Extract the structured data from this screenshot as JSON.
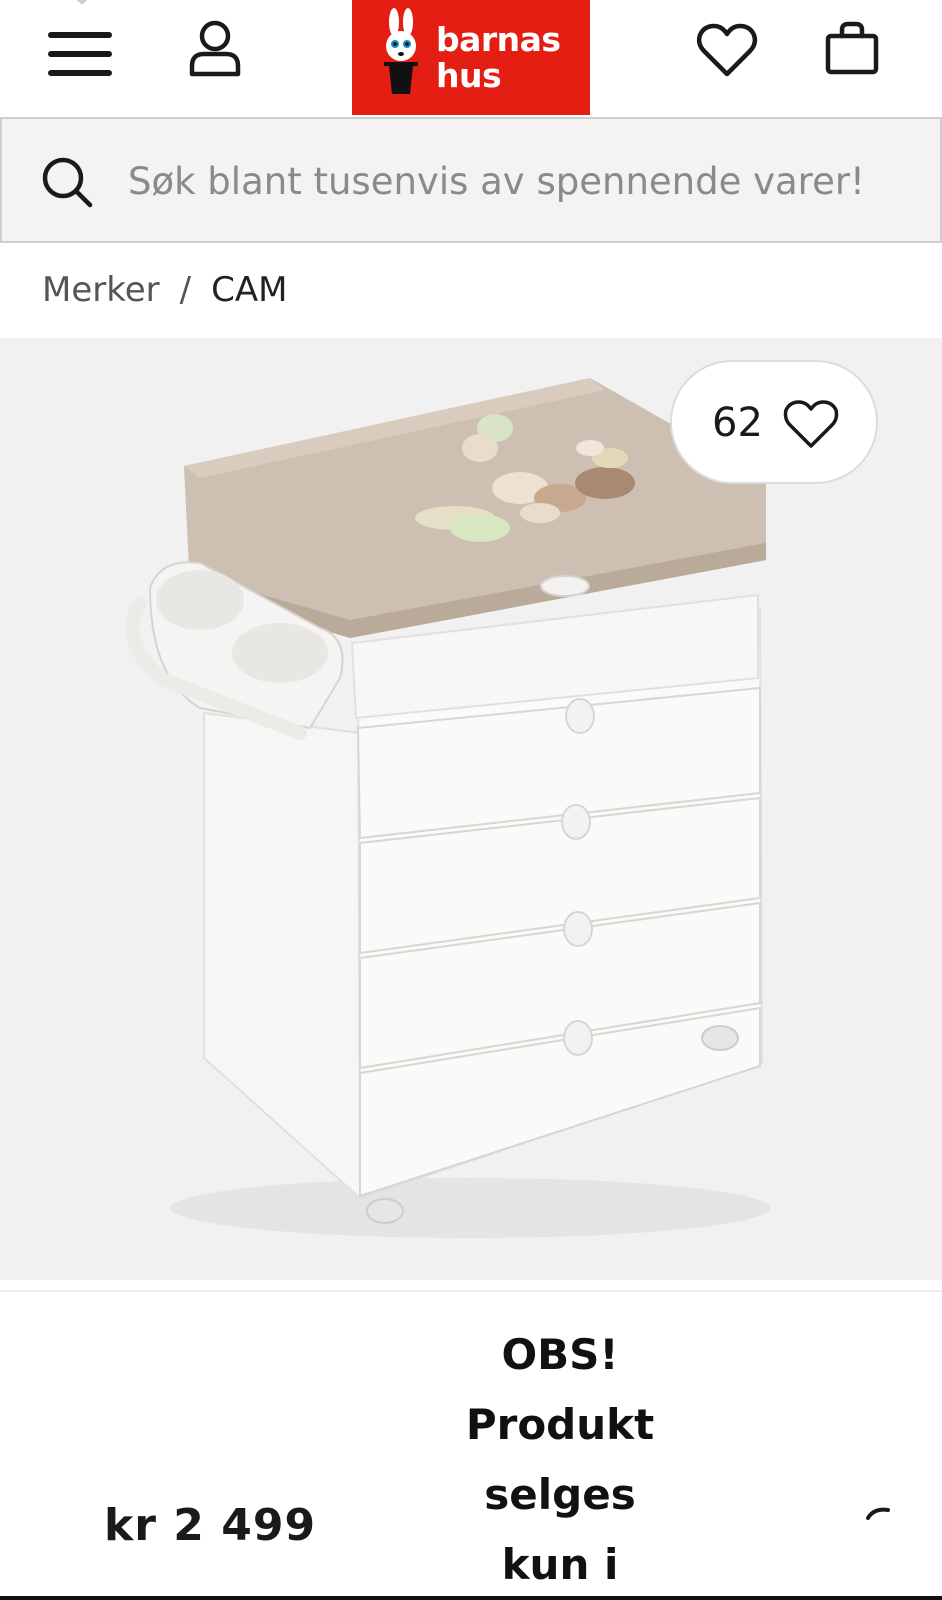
{
  "header": {
    "logo": {
      "line1": "barnas",
      "line2": "hus",
      "bg_color": "#e41e13"
    },
    "icons": [
      "menu-icon",
      "user-icon",
      "heart-icon",
      "bag-icon"
    ]
  },
  "search": {
    "placeholder": "Søk blant tusenvis av spennende varer!"
  },
  "breadcrumb": {
    "items": [
      "Merker",
      "CAM"
    ],
    "separator": "/"
  },
  "product": {
    "favorites_count": "62",
    "price": "kr 2 499",
    "notice_lines": [
      "OBS!",
      "Produkt",
      "selges",
      "kun i"
    ]
  },
  "colors": {
    "brand_red": "#e41e13",
    "image_bg": "#f2f1f1"
  }
}
